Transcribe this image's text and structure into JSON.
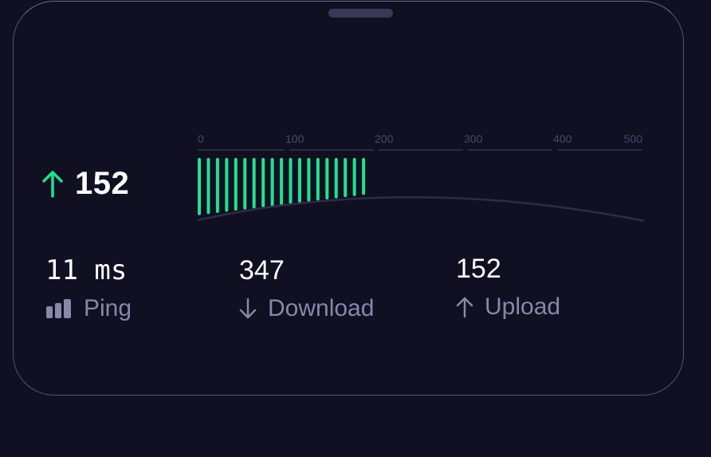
{
  "card": {
    "current_speed": "152",
    "current_direction": "upload"
  },
  "gauge": {
    "ticks": [
      "0",
      "100",
      "200",
      "300",
      "400",
      "500"
    ],
    "range": [
      0,
      500
    ],
    "fill_value": 200,
    "accent_color": "#1fe28e",
    "track_color": "#2c2a45"
  },
  "stats": {
    "ping": {
      "value": "11 ms",
      "label": "Ping",
      "icon": "signal-bars-icon"
    },
    "download": {
      "value": "347",
      "label": "Download",
      "icon": "arrow-down-icon"
    },
    "upload": {
      "value": "152",
      "label": "Upload",
      "icon": "arrow-up-icon"
    }
  }
}
